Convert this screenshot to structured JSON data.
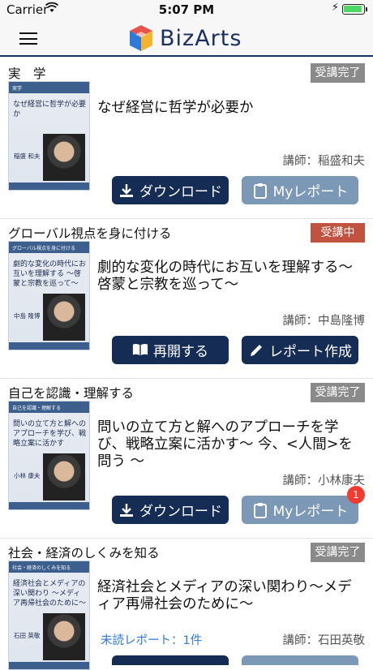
{
  "status_bar": {
    "carrier": "Carrier",
    "time": "5:07 PM"
  },
  "app": {
    "name": "BizArts"
  },
  "courses": [
    {
      "category": "実　学",
      "status": "受講完了",
      "status_type": "done",
      "thumb": {
        "header": "実学",
        "title": "なぜ経営に哲学が必要か",
        "name": "稲盛 和夫"
      },
      "title": "なぜ経営に哲学が必要か",
      "lecturer": "講師：稲盛和夫",
      "buttons": [
        {
          "label": "ダウンロード",
          "icon": "download-icon"
        },
        {
          "label": "Myレポート",
          "icon": "clipboard-icon"
        }
      ]
    },
    {
      "category": "グローバル視点を身に付ける",
      "status": "受講中",
      "status_type": "active",
      "thumb": {
        "header": "グローバル視点を身に付ける",
        "title": "劇的な変化の時代にお互いを理解する 〜啓蒙と宗教を巡って〜",
        "name": "中島 隆博"
      },
      "title": "劇的な変化の時代にお互いを理解する〜啓蒙と宗教を巡って〜",
      "lecturer": "講師：中島隆博",
      "buttons": [
        {
          "label": "再開する",
          "icon": "book-icon"
        },
        {
          "label": "レポート作成",
          "icon": "pencil-icon"
        }
      ]
    },
    {
      "category": "自己を認識・理解する",
      "status": "受講完了",
      "status_type": "done",
      "thumb": {
        "header": "自己を認識・理解する",
        "title": "問いの立て方と解へのアプローチを学び、戦略立案に活かす",
        "name": "小林 康夫"
      },
      "title": "問いの立て方と解へのアプローチを学び、戦略立案に活かす〜 今、<人間>を問う 〜",
      "lecturer": "講師：小林康夫",
      "buttons": [
        {
          "label": "ダウンロード",
          "icon": "download-icon"
        },
        {
          "label": "Myレポート",
          "icon": "clipboard-icon",
          "badge": "1"
        }
      ]
    },
    {
      "category": "社会・経済のしくみを知る",
      "status": "受講完了",
      "status_type": "done",
      "thumb": {
        "header": "社会・経済のしくみを知る",
        "title": "経済社会とメディアの深い関わり 〜メディア再帰社会のために〜",
        "name": "石田 英敬"
      },
      "title": "経済社会とメディアの深い関わり〜メディア再帰社会のために〜",
      "lecturer": "講師：石田英敬",
      "unread": "未読レポート：1件"
    }
  ],
  "colors": {
    "navy": "#152c55",
    "steel": "#7b98b7",
    "done": "#8a8a8a",
    "active": "#c0523f",
    "badge": "#f23a2e"
  }
}
